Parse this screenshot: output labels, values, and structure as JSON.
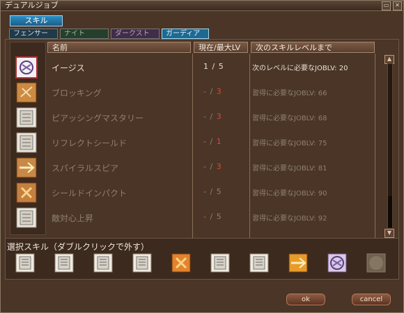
{
  "window": {
    "title": "デュアルジョブ"
  },
  "main_tab": {
    "label": "スキル"
  },
  "class_tabs": [
    {
      "label": "フェンサー"
    },
    {
      "label": "ナイト"
    },
    {
      "label": "ダークストーカー"
    },
    {
      "label": "ガーディアン"
    }
  ],
  "headers": {
    "name": "名前",
    "lv": "現在/最大LV",
    "req": "次のスキルレベルまで"
  },
  "skills": [
    {
      "name": "イージス",
      "current": "1",
      "max": "5",
      "req": "次のレベルに必要なJOBLV: 20",
      "active": true,
      "max_red": false
    },
    {
      "name": "ブロッキング",
      "current": "-",
      "max": "3",
      "req": "習得に必要なJOBLV: 66",
      "active": false,
      "max_red": true
    },
    {
      "name": "ピアッシングマスタリー",
      "current": "-",
      "max": "3",
      "req": "習得に必要なJOBLV: 68",
      "active": false,
      "max_red": true
    },
    {
      "name": "リフレクトシールド",
      "current": "-",
      "max": "1",
      "req": "習得に必要なJOBLV: 75",
      "active": false,
      "max_red": true
    },
    {
      "name": "スパイラルスピア",
      "current": "-",
      "max": "3",
      "req": "習得に必要なJOBLV: 81",
      "active": false,
      "max_red": true
    },
    {
      "name": "シールドインパクト",
      "current": "-",
      "max": "5",
      "req": "習得に必要なJOBLV: 90",
      "active": false,
      "max_red": false
    },
    {
      "name": "敵対心上昇",
      "current": "-",
      "max": "5",
      "req": "習得に必要なJOBLV: 92",
      "active": false,
      "max_red": false
    }
  ],
  "selected": {
    "label": "選択スキル（ダブルクリックで外す）"
  },
  "buttons": {
    "ok": "ok",
    "cancel": "cancel"
  }
}
